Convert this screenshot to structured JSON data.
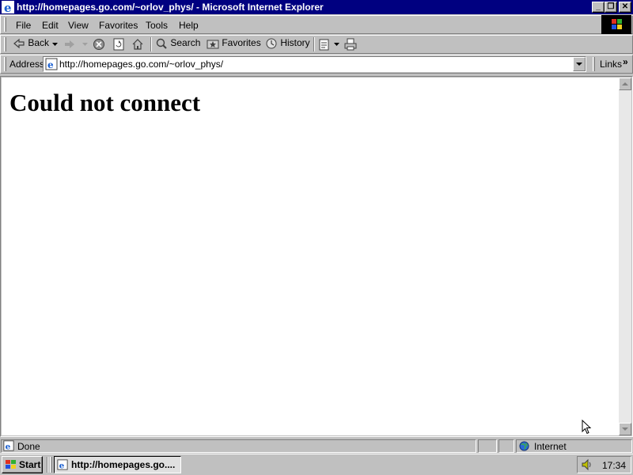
{
  "window": {
    "title": "http://homepages.go.com/~orlov_phys/ - Microsoft Internet Explorer",
    "buttons": {
      "minimize": "_",
      "restore": "❐",
      "close": "✕"
    }
  },
  "menu": [
    {
      "label": "File"
    },
    {
      "label": "Edit"
    },
    {
      "label": "View"
    },
    {
      "label": "Favorites"
    },
    {
      "label": "Tools"
    },
    {
      "label": "Help"
    }
  ],
  "toolbar": {
    "back": "Back",
    "search": "Search",
    "favorites": "Favorites",
    "history": "History"
  },
  "address": {
    "label": "Address",
    "url": "http://homepages.go.com/~orlov_phys/",
    "links": "Links"
  },
  "page": {
    "heading": "Could not connect"
  },
  "status": {
    "text": "Done",
    "zone": "Internet"
  },
  "taskbar": {
    "start": "Start",
    "task": "http://homepages.go....",
    "clock": "17:34"
  },
  "colors": {
    "titlebar": "#000080",
    "chrome": "#c0c0c0",
    "page_bg": "#ffffff"
  }
}
